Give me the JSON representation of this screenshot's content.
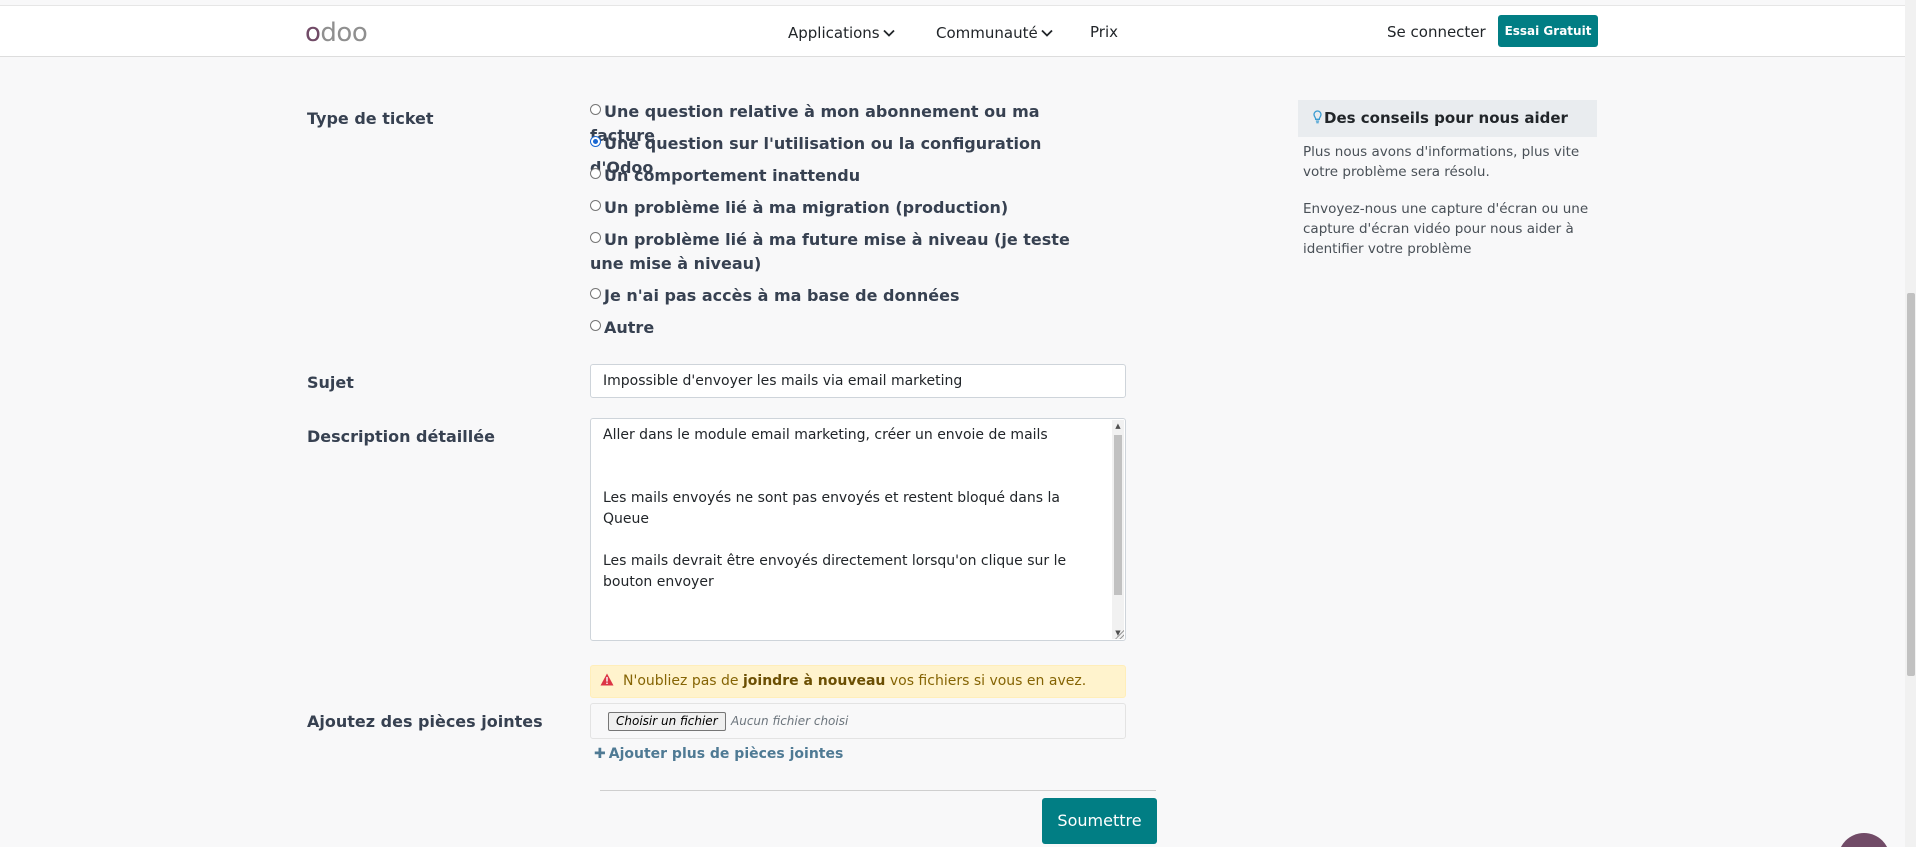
{
  "header": {
    "logo": "odoo",
    "nav": [
      {
        "label": "Applications",
        "has_dropdown": true
      },
      {
        "label": "Communauté",
        "has_dropdown": true
      },
      {
        "label": "Prix",
        "has_dropdown": false
      }
    ],
    "login_label": "Se connecter",
    "trial_label": "Essai Gratuit"
  },
  "form": {
    "ticket_type": {
      "label": "Type de ticket",
      "options": [
        {
          "label": "Une question relative à mon abonnement ou ma facture",
          "selected": false
        },
        {
          "label": "Une question sur l'utilisation ou la configuration d'Odoo",
          "selected": true
        },
        {
          "label": "Un comportement inattendu",
          "selected": false
        },
        {
          "label": "Un problème lié à ma migration (production)",
          "selected": false
        },
        {
          "label": "Un problème lié à ma future mise à niveau (je teste une mise à niveau)",
          "selected": false
        },
        {
          "label": "Je n'ai pas accès à ma base de données",
          "selected": false
        },
        {
          "label": "Autre",
          "selected": false
        }
      ]
    },
    "subject": {
      "label": "Sujet",
      "value": "Impossible d'envoyer les mails via email marketing"
    },
    "description": {
      "label": "Description détaillée",
      "paragraphs": [
        "Aller dans le module email marketing, créer un envoie de mails",
        "Les mails envoyés ne sont pas envoyés et restent bloqué dans la Queue",
        "Les mails devrait être envoyés directement lorsqu'on clique sur le bouton envoyer"
      ]
    },
    "attachments": {
      "label": "Ajoutez des pièces jointes",
      "alert_before": "N'oubliez pas de ",
      "alert_bold": "joindre à nouveau",
      "alert_after": " vos fichiers si vous en avez.",
      "choose_file_label": "Choisir un fichier",
      "no_file_label": "Aucun fichier choisi",
      "add_more_label": "Ajouter plus de pièces jointes"
    },
    "submit_label": "Soumettre"
  },
  "tips": {
    "title": "Des conseils pour nous aider",
    "paragraphs": [
      "Plus nous avons d'informations, plus vite votre problème sera résolu.",
      "Envoyez-nous une capture d'écran ou une capture d'écran vidéo pour nous aider à identifier votre problème"
    ]
  },
  "colors": {
    "accent": "#017e84",
    "brand": "#714b67",
    "alert_bg": "#fff3cd"
  }
}
